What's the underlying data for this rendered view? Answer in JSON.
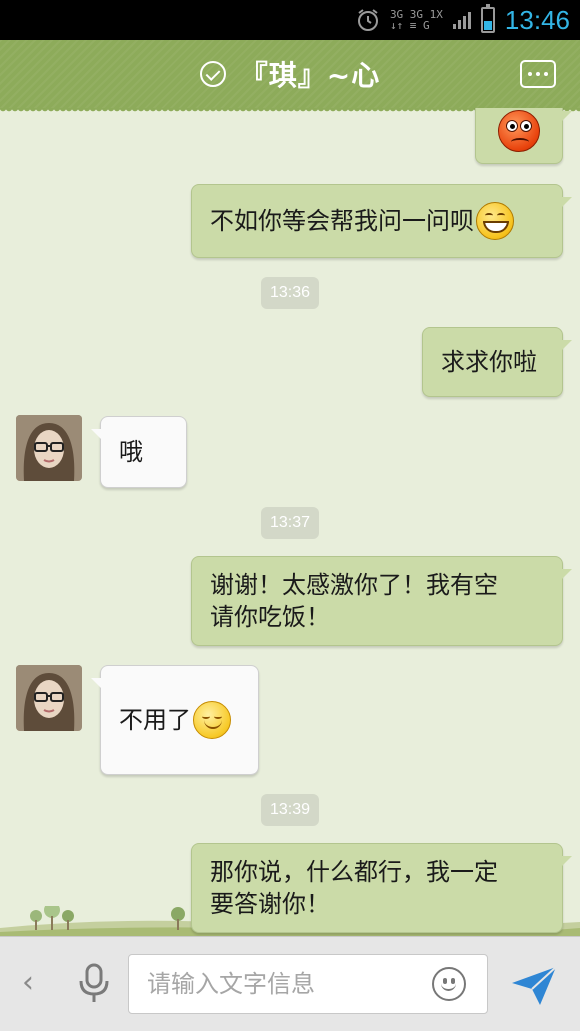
{
  "status_bar": {
    "net_top": "3G 3G 1X",
    "net_bottom": "↓↑ ≡ G",
    "time": "13:46"
  },
  "header": {
    "title": "『琪』~心",
    "check_icon": "check-circle-icon",
    "menu_icon": "more-dots-icon"
  },
  "messages": [
    {
      "type": "sent",
      "emoji": "angry-face-icon"
    },
    {
      "type": "sent",
      "text": "不如你等会帮我问一问呗",
      "emoji": "grin-face-icon"
    },
    {
      "type": "time",
      "text": "13:36"
    },
    {
      "type": "sent",
      "text": "求求你啦"
    },
    {
      "type": "received",
      "text": "哦"
    },
    {
      "type": "time",
      "text": "13:37"
    },
    {
      "type": "sent",
      "lines": [
        "谢谢！太感激你了！我有空",
        "请你吃饭！"
      ]
    },
    {
      "type": "received",
      "text": "不用了",
      "emoji": "smile-face-icon"
    },
    {
      "type": "time",
      "text": "13:39"
    },
    {
      "type": "sent",
      "lines": [
        "那你说，什么都行，我一定",
        "要答谢你！"
      ]
    }
  ],
  "input_bar": {
    "back_glyph": "‹",
    "placeholder": "请输入文字信息",
    "colors": {
      "send": "#2f86d4",
      "header": "#8dab5a",
      "sent_bubble": "#cbdba8"
    }
  }
}
